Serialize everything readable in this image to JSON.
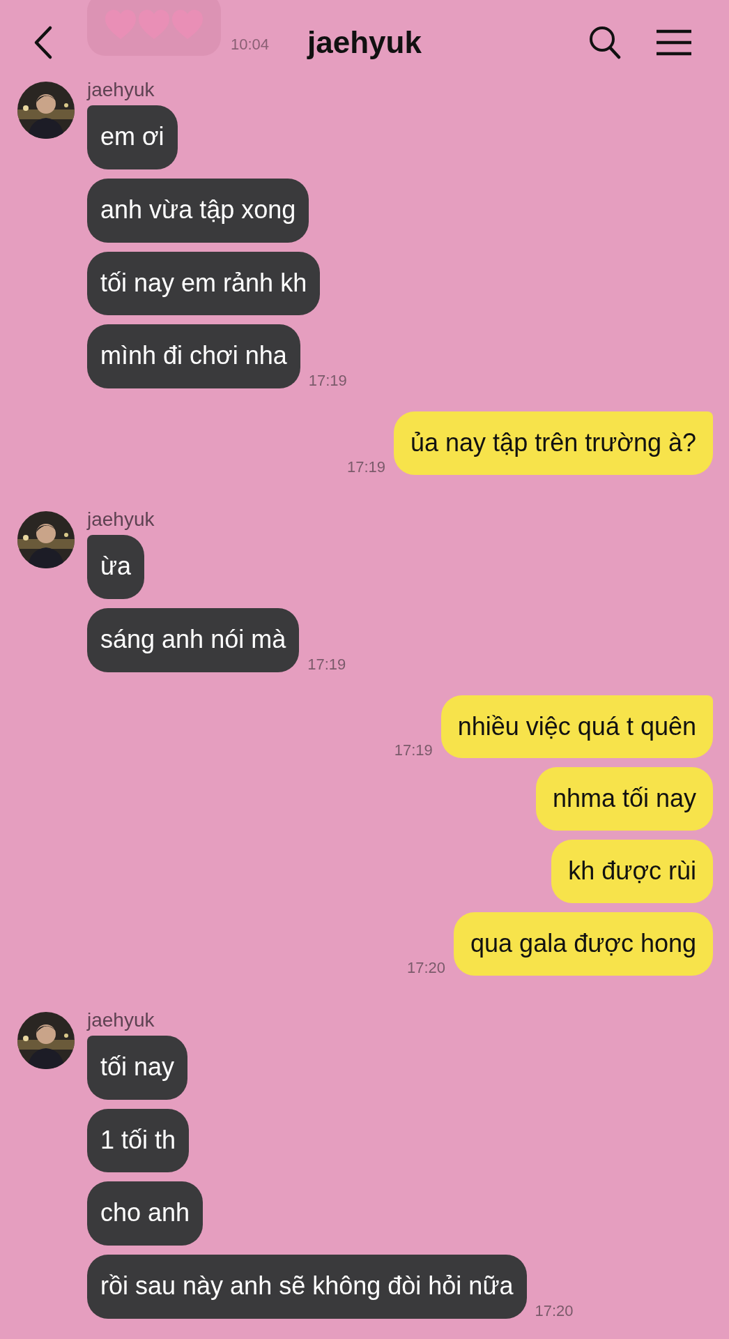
{
  "header": {
    "title": "jaehyuk"
  },
  "faded_message": {
    "time": "10:04"
  },
  "groups": [
    {
      "kind": "received",
      "sender": "jaehyuk",
      "bubbles": [
        {
          "text": "em ơi"
        },
        {
          "text": "anh vừa tập xong"
        },
        {
          "text": "tối nay em rảnh kh"
        },
        {
          "text": "mình đi chơi nha",
          "time": "17:19"
        }
      ]
    },
    {
      "kind": "sent",
      "bubbles": [
        {
          "text": "ủa nay tập trên trường à?",
          "time": "17:19"
        }
      ]
    },
    {
      "kind": "received",
      "sender": "jaehyuk",
      "bubbles": [
        {
          "text": "ừa"
        },
        {
          "text": "sáng anh nói mà",
          "time": "17:19"
        }
      ]
    },
    {
      "kind": "sent",
      "bubbles": [
        {
          "text": "nhiều việc quá t quên",
          "time": "17:19"
        },
        {
          "text": "nhma tối nay"
        },
        {
          "text": "kh được rùi"
        },
        {
          "text": "qua gala được hong",
          "time": "17:20"
        }
      ]
    },
    {
      "kind": "received",
      "sender": "jaehyuk",
      "bubbles": [
        {
          "text": "tối nay"
        },
        {
          "text": "1 tối th"
        },
        {
          "text": "cho anh"
        },
        {
          "text": "rồi sau này anh sẽ không đòi hỏi nữa",
          "time": "17:20"
        }
      ]
    }
  ]
}
